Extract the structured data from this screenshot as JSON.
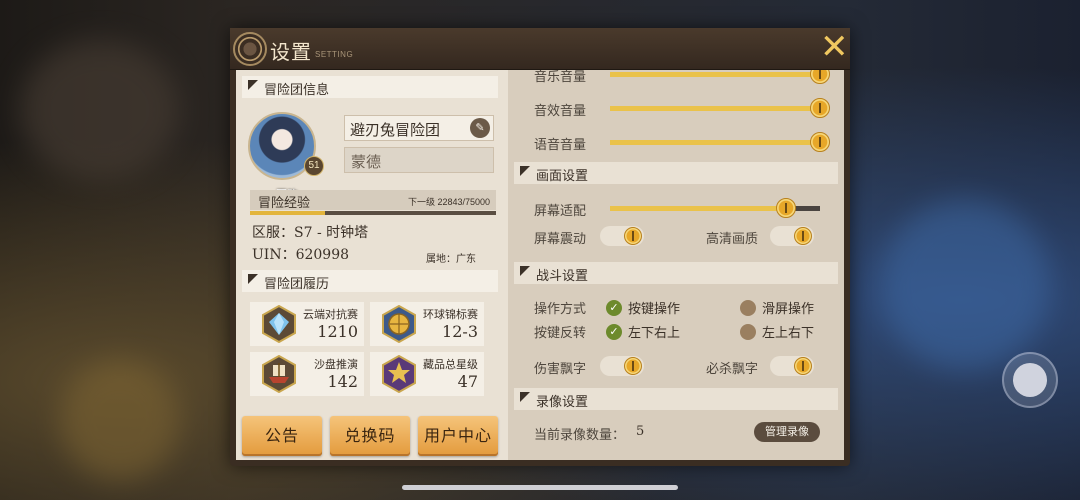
{
  "window": {
    "title": "设置",
    "subtitle": "SETTING"
  },
  "left": {
    "header_info": "冒险团信息",
    "level": "51",
    "change_label": "更改",
    "team_name": "避刃兔冒险团",
    "guild_name": "蒙德",
    "exp_label": "冒险经验",
    "exp_next": "下一级 22843/75000",
    "exp_progress": 0.3046,
    "server": "区服：S7 - 时钟塔",
    "uin": "UIN：620998",
    "location": "属地：广东",
    "header_history": "冒险团履历",
    "stats": [
      {
        "name": "云端对抗赛",
        "value": "1210",
        "icon": "diamond-badge-icon"
      },
      {
        "name": "环球锦标赛",
        "value": "12-3",
        "icon": "gold-orb-icon"
      },
      {
        "name": "沙盘推演",
        "value": "142",
        "icon": "ship-badge-icon"
      },
      {
        "name": "藏品总星级",
        "value": "47",
        "icon": "star-figure-icon"
      }
    ],
    "buttons": {
      "announcement": "公告",
      "redeem": "兑换码",
      "user_center": "用户中心"
    }
  },
  "right": {
    "audio": [
      {
        "label": "音乐音量",
        "level": 1.0
      },
      {
        "label": "音效音量",
        "level": 1.0
      },
      {
        "label": "语音音量",
        "level": 1.0
      }
    ],
    "display_header": "画面设置",
    "screen_fit": {
      "label": "屏幕适配",
      "level": 0.84
    },
    "screen_shake": {
      "label": "屏幕震动",
      "on": true
    },
    "hd": {
      "label": "高清画质",
      "on": true
    },
    "battle_header": "战斗设置",
    "control_mode": {
      "label": "操作方式",
      "opt1": "按键操作",
      "opt2": "滑屏操作",
      "selected": "按键操作"
    },
    "key_flip": {
      "label": "按键反转",
      "opt1": "左下右上",
      "opt2": "左上右下",
      "selected": "左下右上"
    },
    "damage_float": {
      "label": "伤害飘字",
      "on": true
    },
    "crit_float": {
      "label": "必杀飘字",
      "on": true
    },
    "record_header": "录像设置",
    "record_count_label": "当前录像数量：",
    "record_count": "5",
    "manage_button": "管理录像"
  },
  "colors": {
    "accent": "#e3b53c",
    "button": "#f0b060",
    "check": "#6d8a2c"
  }
}
